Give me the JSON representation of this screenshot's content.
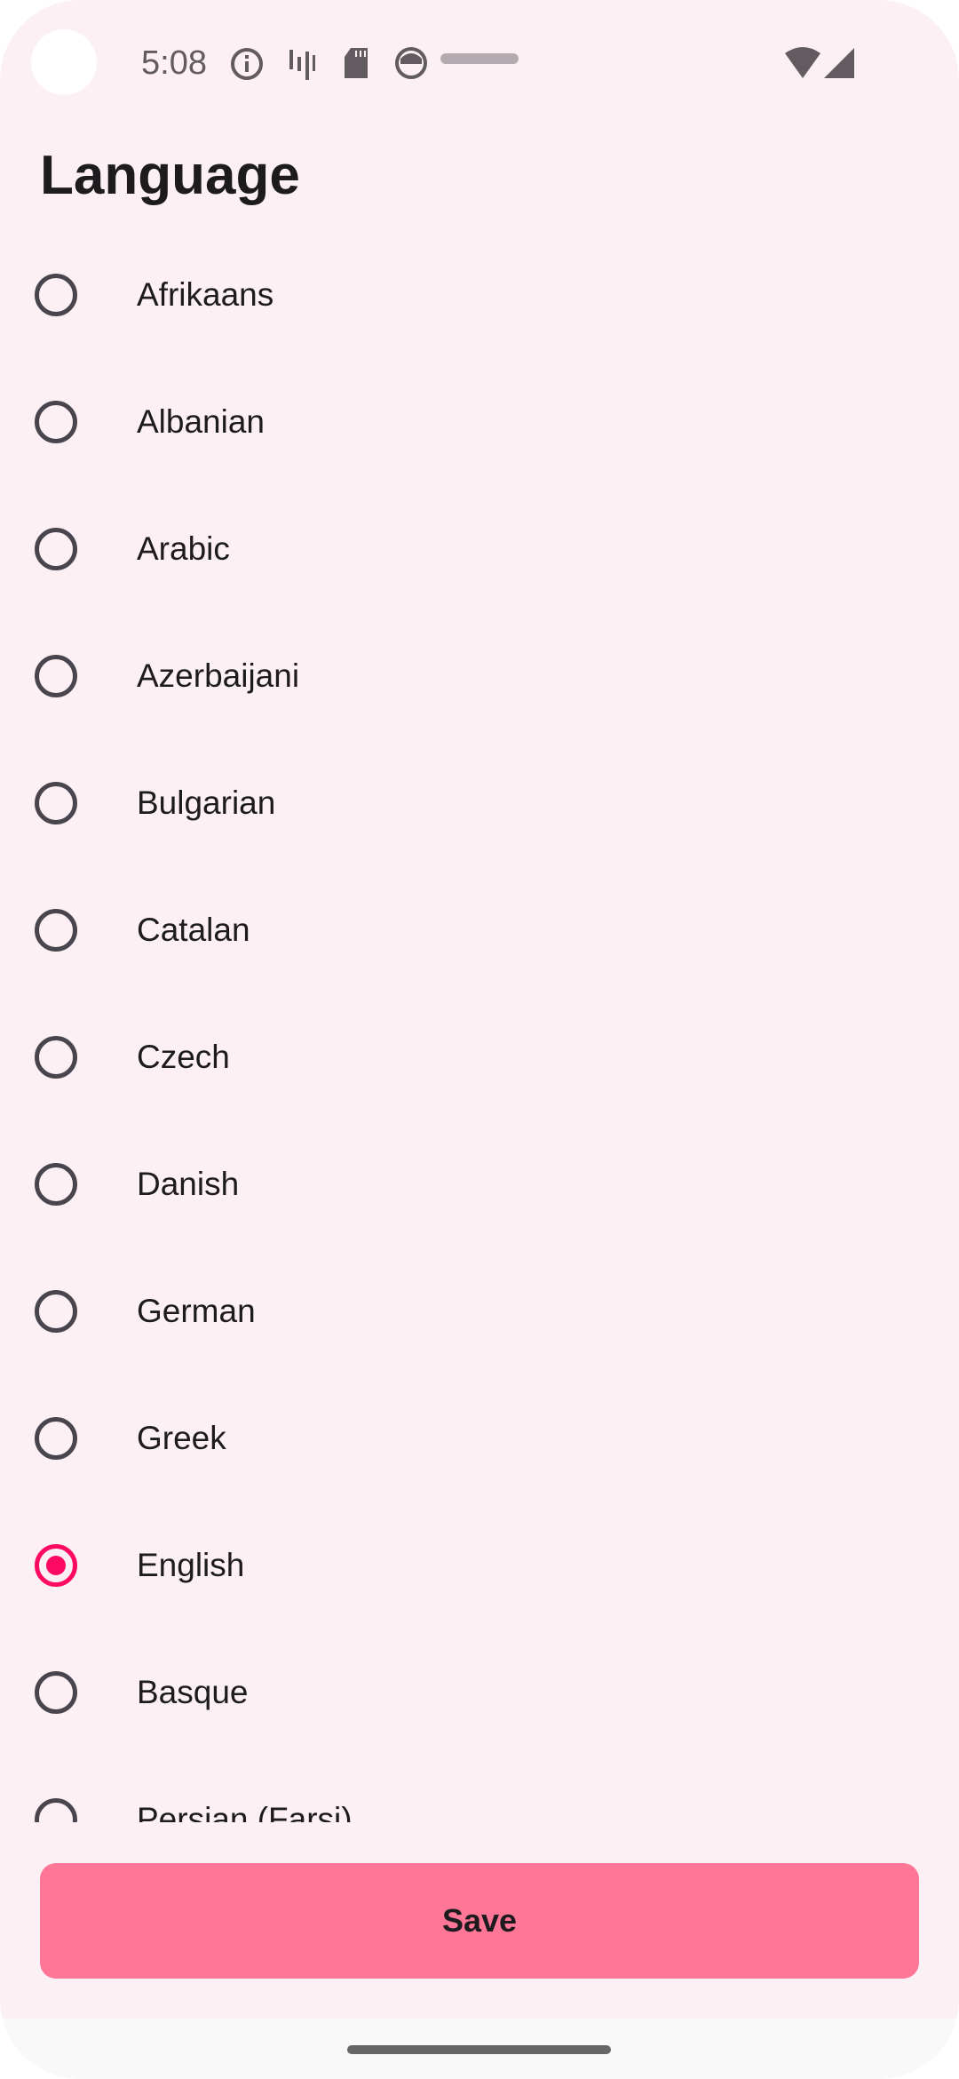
{
  "status_bar": {
    "time": "5:08",
    "icons": [
      "info-icon",
      "audio-wave-icon",
      "sd-card-icon",
      "android-face-icon",
      "progress-pill-icon",
      "wifi-icon",
      "cell-signal-icon"
    ]
  },
  "page": {
    "title": "Language"
  },
  "languages": [
    {
      "label": "Afrikaans",
      "selected": false
    },
    {
      "label": "Albanian",
      "selected": false
    },
    {
      "label": "Arabic",
      "selected": false
    },
    {
      "label": "Azerbaijani",
      "selected": false
    },
    {
      "label": "Bulgarian",
      "selected": false
    },
    {
      "label": "Catalan",
      "selected": false
    },
    {
      "label": "Czech",
      "selected": false
    },
    {
      "label": "Danish",
      "selected": false
    },
    {
      "label": "German",
      "selected": false
    },
    {
      "label": "Greek",
      "selected": false
    },
    {
      "label": "English",
      "selected": true
    },
    {
      "label": "Basque",
      "selected": false
    },
    {
      "label": "Persian (Farsi)",
      "selected": false
    }
  ],
  "actions": {
    "save_label": "Save"
  },
  "colors": {
    "background": "#FDF0F4",
    "accent": "#FF0A63",
    "button": "#FF7697"
  }
}
